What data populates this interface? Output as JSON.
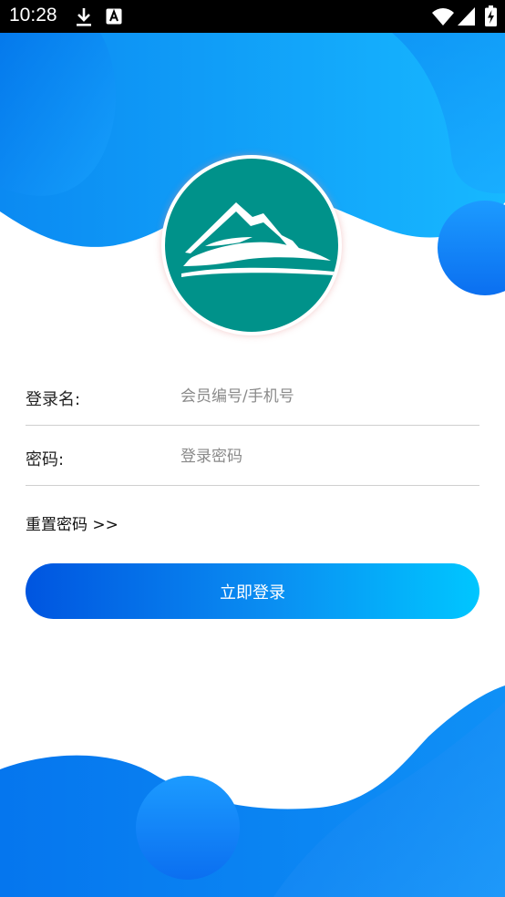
{
  "status_bar": {
    "time": "10:28",
    "icons": [
      "download-icon",
      "font-a-icon",
      "wifi-icon",
      "signal-icon",
      "battery-charging-icon"
    ]
  },
  "logo": {
    "icon": "mountain-logo-icon",
    "color": "#00928a"
  },
  "form": {
    "username": {
      "label": "登录名:",
      "placeholder": "会员编号/手机号",
      "value": ""
    },
    "password": {
      "label": "密码:",
      "placeholder": "登录密码",
      "value": ""
    },
    "reset_link": "重置密码 >>"
  },
  "login_button": {
    "label": "立即登录"
  },
  "colors": {
    "accent_start": "#0055e0",
    "accent_end": "#00c6ff",
    "wave": "#0a8ff2",
    "logo": "#00928a"
  }
}
